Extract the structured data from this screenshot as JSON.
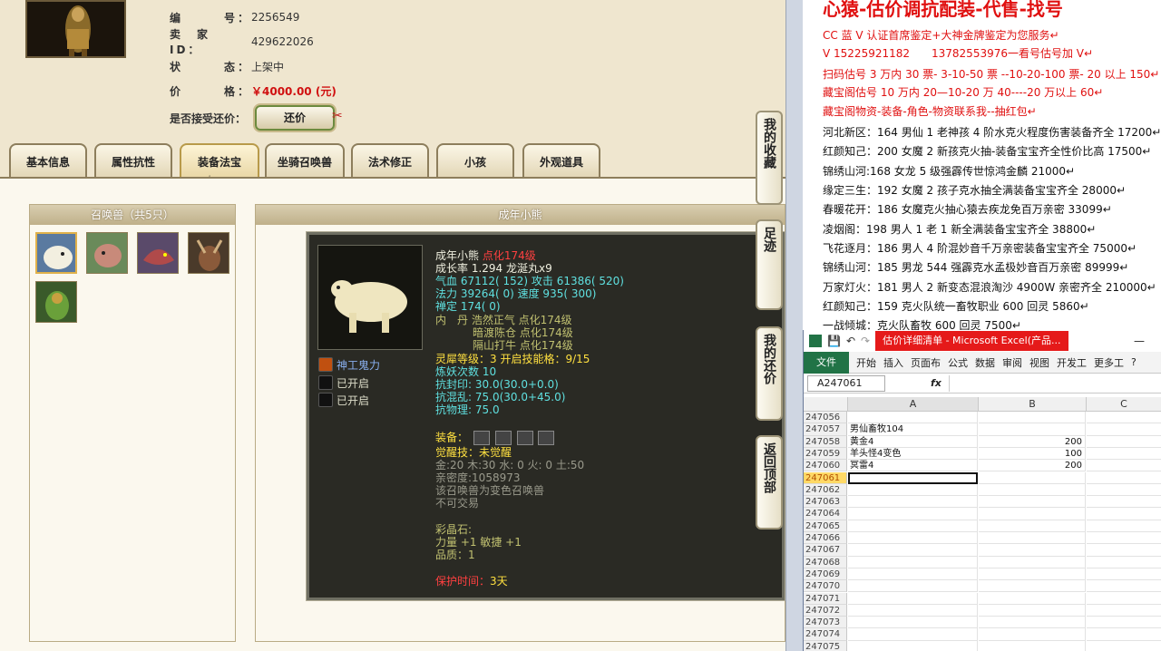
{
  "listing": {
    "number_label": "编　　　号：",
    "number": "2256549",
    "seller_label": "卖　家　ID：",
    "seller_id": "429622026",
    "status_label": "状　　　态：",
    "status": "上架中",
    "price_label": "价　　　格：",
    "price": "￥4000.00 (元)",
    "counter_offer_label": "是否接受还价：",
    "counter_offer_button": "还价"
  },
  "tabs": [
    "基本信息",
    "属性抗性",
    "装备法宝",
    "坐骑召唤兽",
    "法术修正",
    "小孩",
    "外观道具"
  ],
  "active_tab": 3,
  "pet_list": {
    "title": "召唤兽（共5只）",
    "count": 5
  },
  "pet_detail": {
    "panel_title": "成年小熊",
    "name": "成年小熊",
    "tag": "点化174级",
    "growth": "成长率 1.294 龙涎丸x9",
    "hp": "气血 67112( 152) 攻击 61386( 520)",
    "mp": "法力 39264( 0) 速度 935( 300)",
    "zen": "禅定 174( 0)",
    "inner": "内　丹 浩然正气 点化174级",
    "inner2": "暗渡陈仓 点化174级",
    "inner3": "隔山打牛 点化174级",
    "spirit": "灵犀等级：3 开启技能格：9/15",
    "refine": "炼妖次数 10",
    "resist_seal": "抗封印: 30.0(30.0+0.0)",
    "resist_chaos": "抗混乱: 75.0(30.0+45.0)",
    "resist_phys": "抗物理: 75.0",
    "equip_label": "装备：",
    "awaken": "觉醒技：未觉醒",
    "elements": "金:20 木:30 水: 0 火: 0 土:50",
    "intimacy": "亲密度:1058973",
    "variant": "该召唤兽为变色召唤兽",
    "untradeable": "不可交易",
    "gem_label": "彩晶石:",
    "gem_stats": "力量 +1 敏捷 +1",
    "quality": "品质：1",
    "protect_label": "保护时间：",
    "protect_value": "3天",
    "skills": [
      "神工鬼力",
      "已开启",
      "已开启"
    ]
  },
  "side_buttons": [
    "我的收藏",
    "足迹",
    "我的还价",
    "返回顶部"
  ],
  "ad": {
    "title": "心猿-估价调抗配装-代售-找号",
    "lines": [
      {
        "text": "CC 蓝 V 认证首席鉴定+大神金牌鉴定为您服务↵",
        "color": "red"
      },
      {
        "text": "V 15225921182　　13782553976一看号估号加 V↵",
        "color": "red"
      },
      {
        "text": "扫码估号 3 万内 30 票- 3-10-50 票 --10-20-100 票- 20 以上 150↵",
        "color": "red"
      },
      {
        "text": "藏宝阁估号 10 万内 20—10-20 万 40----20 万以上 60↵",
        "color": "red"
      },
      {
        "text": "藏宝阁物资-装备-角色-物资联系我--抽红包↵",
        "color": "red"
      },
      {
        "text": "河北新区：164 男仙 1 老神孩 4 阶水克火程度伤害装备齐全 17200↵",
        "color": "blk"
      },
      {
        "text": "红颜知己：200 女魔 2 新孩克火抽-装备宝宝齐全性价比高 17500↵",
        "color": "blk"
      },
      {
        "text": "锦绣山河:168 女龙 5 级强霹传世惊鸿金麟 21000↵",
        "color": "blk"
      },
      {
        "text": "缘定三生：192 女魔 2 孩子克水抽全满装备宝宝齐全 28000↵",
        "color": "blk"
      },
      {
        "text": "春暖花开：186 女魔克火抽心猿去疾龙免百万亲密 33099↵",
        "color": "blk"
      },
      {
        "text": "凌烟阁：198 男人 1 老 1 新全满装备宝宝齐全 38800↵",
        "color": "blk"
      },
      {
        "text": "飞花逐月：186 男人 4 阶混妙音千万亲密装备宝宝齐全 75000↵",
        "color": "blk"
      },
      {
        "text": "锦绣山河：185 男龙 544 强霹克水孟极妙音百万亲密 89999↵",
        "color": "blk"
      },
      {
        "text": "万家灯火：181 男人 2 新变态混浪淘沙 4900W 亲密齐全 210000↵",
        "color": "blk"
      },
      {
        "text": "红颜知己：159 克火队统一畜牧职业 600 回灵 5860↵",
        "color": "blk"
      },
      {
        "text": "一战倾城：克火队畜牧 600 回灵 7500↵",
        "color": "blk"
      }
    ]
  },
  "excel": {
    "window_title": "估价详细清单 - Microsoft Excel(产品...",
    "ribbon_tabs": [
      "开始",
      "插入",
      "页面布",
      "公式",
      "数据",
      "审阅",
      "视图",
      "开发工",
      "更多工"
    ],
    "file_tab": "文件",
    "name_box": "A247061",
    "fx": "fx",
    "columns": [
      "A",
      "B",
      "C"
    ],
    "rows": [
      {
        "n": "247056",
        "a": "",
        "b": ""
      },
      {
        "n": "247057",
        "a": "男仙畜牧104",
        "b": ""
      },
      {
        "n": "247058",
        "a": "黄金4",
        "b": "200"
      },
      {
        "n": "247059",
        "a": "羊头怪4变色",
        "b": "100"
      },
      {
        "n": "247060",
        "a": "冥雷4",
        "b": "200"
      },
      {
        "n": "247061",
        "a": "",
        "b": ""
      },
      {
        "n": "247062",
        "a": "",
        "b": ""
      },
      {
        "n": "247063",
        "a": "",
        "b": ""
      },
      {
        "n": "247064",
        "a": "",
        "b": ""
      },
      {
        "n": "247065",
        "a": "",
        "b": ""
      },
      {
        "n": "247066",
        "a": "",
        "b": ""
      },
      {
        "n": "247067",
        "a": "",
        "b": ""
      },
      {
        "n": "247068",
        "a": "",
        "b": ""
      },
      {
        "n": "247069",
        "a": "",
        "b": ""
      },
      {
        "n": "247070",
        "a": "",
        "b": ""
      },
      {
        "n": "247071",
        "a": "",
        "b": ""
      },
      {
        "n": "247072",
        "a": "",
        "b": ""
      },
      {
        "n": "247073",
        "a": "",
        "b": ""
      },
      {
        "n": "247074",
        "a": "",
        "b": ""
      },
      {
        "n": "247075",
        "a": "",
        "b": ""
      }
    ],
    "active_row": "247061"
  },
  "colors": {
    "price_red": "#d01010",
    "excel_green": "#217346",
    "ad_red": "#e01010"
  }
}
